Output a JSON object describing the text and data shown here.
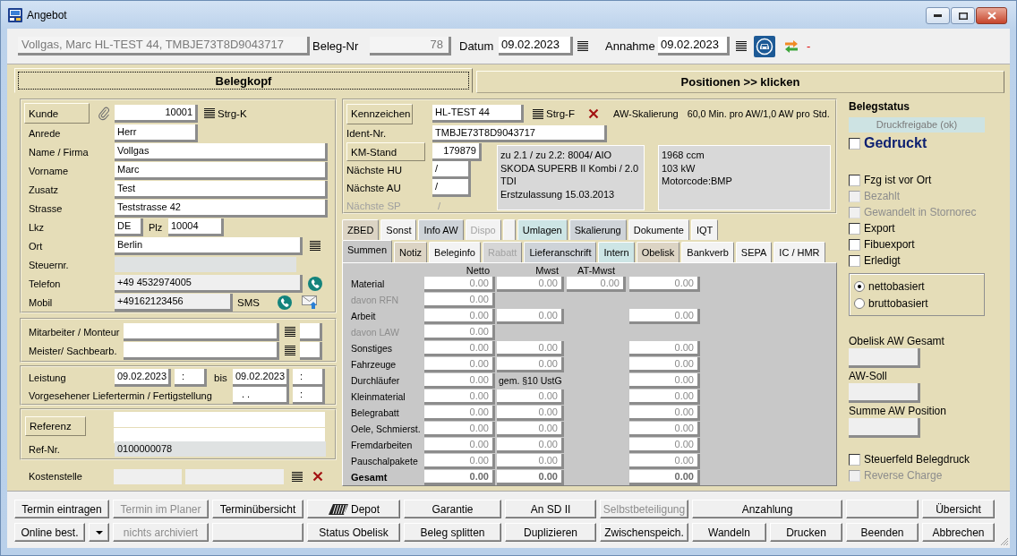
{
  "window": {
    "title": "Angebot"
  },
  "header": {
    "summary": "Vollgas, Marc HL-TEST 44, TMBJE73T8D9043717",
    "beleg_nr_label": "Beleg-Nr",
    "beleg_nr": "78",
    "datum_label": "Datum",
    "datum": "09.02.2023",
    "annahme_label": "Annahme",
    "annahme": "09.02.2023",
    "status": "-"
  },
  "main_tabs": [
    {
      "label": "Belegkopf",
      "selected": true
    },
    {
      "label": "Positionen >> klicken",
      "selected": false
    }
  ],
  "customer": {
    "kunde_button": "Kunde",
    "kunde": "10001",
    "kunde_shortcut": "Strg-K",
    "fields": [
      {
        "kind": "short",
        "label": "Anrede",
        "value": "Herr"
      },
      {
        "kind": "full",
        "label": "Name / Firma",
        "value": "Vollgas"
      },
      {
        "kind": "full",
        "label": "Vorname",
        "value": "Marc"
      },
      {
        "kind": "full",
        "label": "Zusatz",
        "value": "Test"
      },
      {
        "kind": "full",
        "label": "Strasse",
        "value": "Teststrasse 42"
      },
      {
        "kind": "country",
        "label": "Lkz",
        "value": "DE",
        "plz_label": "Plz",
        "plz": "10004"
      },
      {
        "kind": "lookup",
        "label": "Ort",
        "value": "Berlin"
      },
      {
        "kind": "locked",
        "label": "Steuernr."
      },
      {
        "kind": "phone",
        "label": "Telefon",
        "value": "+49 4532974005"
      },
      {
        "kind": "mobile",
        "label": "Mobil",
        "value": "+49162123456",
        "sms_label": "SMS"
      }
    ]
  },
  "staff": [
    {
      "label": "Mitarbeiter / Monteur"
    },
    {
      "label": "Meister/ Sachbearb."
    }
  ],
  "service_period": {
    "label": "Leistung",
    "from_date": "09.02.2023",
    "from_time": ":",
    "to_label": "bis",
    "to_date": "09.02.2023",
    "to_time": ":"
  },
  "delivery": {
    "label": "Vorgesehener Liefertermin / Fertigstellung",
    "date": ". .",
    "time": ":"
  },
  "reference": {
    "button": "Referenz",
    "ref_nr_label": "Ref-Nr.",
    "ref_nr": "0100000078"
  },
  "cost_center": {
    "label": "Kostenstelle"
  },
  "vehicle": {
    "plate_button": "Kennzeichen",
    "plate": "HL-TEST 44",
    "plate_shortcut": "Strg-F",
    "scaling_label": "AW-Skalierung",
    "scaling": "60,0 Min. pro AW/1,0 AW pro Std.",
    "ident_label": "Ident-Nr.",
    "ident": "TMBJE73T8D9043717",
    "km_button": "KM-Stand",
    "km": "179879",
    "inspections": [
      {
        "label": "Nächste HU",
        "value": "/",
        "disabled": false
      },
      {
        "label": "Nächste AU",
        "value": "/",
        "disabled": false
      },
      {
        "label": "Nächste SP",
        "value": "/",
        "disabled": true
      }
    ],
    "model_lines": [
      "zu 2.1 / zu 2.2: 8004/ AIO",
      "SKODA SUPERB II Kombi / 2.0",
      "TDI",
      "Erstzulassung 15.03.2013"
    ],
    "engine_lines": [
      "1968 ccm",
      "103 kW",
      "Motorcode:BMP"
    ]
  },
  "detail_tab_rows": [
    {
      "tabs": [
        {
          "label": "ZBED",
          "selected": false,
          "disabled": false,
          "color": "#dcd4c4"
        },
        {
          "label": "Sonst",
          "selected": false,
          "disabled": false,
          "color": "#f3f3f3"
        },
        {
          "label": "Info AW",
          "selected": false,
          "disabled": false,
          "color": "#ced3d8"
        },
        {
          "label": "Dispo",
          "selected": false,
          "disabled": true,
          "color": "#f3f3f3"
        },
        {
          "selected": false,
          "color": "#f3f3f3"
        },
        {
          "label": "Umlagen",
          "selected": false,
          "disabled": false,
          "color": "#cde5e5"
        },
        {
          "label": "Skalierung",
          "selected": false,
          "disabled": false,
          "color": "#ced3d8"
        },
        {
          "label": "Dokumente",
          "selected": false,
          "disabled": false,
          "color": "#f3f3f3"
        },
        {
          "label": "IQT",
          "selected": false,
          "disabled": false,
          "color": "#f3f3f3"
        }
      ]
    },
    {
      "tabs": [
        {
          "label": "Summen",
          "selected": true,
          "disabled": false,
          "color": "#c8c8c8"
        },
        {
          "label": "Notiz",
          "selected": false,
          "disabled": false,
          "color": "#dcd4c4"
        },
        {
          "label": "Beleginfo",
          "selected": false,
          "disabled": false,
          "color": "#f3f3f3"
        },
        {
          "label": "Rabatt",
          "selected": false,
          "disabled": true,
          "color": "#d6d6d6"
        },
        {
          "label": "Lieferanschrift",
          "selected": false,
          "disabled": false,
          "color": "#ced3d8"
        },
        {
          "label": "Intern",
          "selected": false,
          "disabled": false,
          "color": "#cde5e5"
        },
        {
          "label": "Obelisk",
          "selected": false,
          "disabled": false,
          "color": "#dcd4c4"
        },
        {
          "label": "Bankverb",
          "selected": false,
          "disabled": false,
          "color": "#f3f3f3"
        },
        {
          "label": "SEPA",
          "selected": false,
          "disabled": false,
          "color": "#f3f3f3"
        },
        {
          "label": "IC / HMR",
          "selected": false,
          "disabled": false,
          "color": "#f3f3f3"
        }
      ]
    }
  ],
  "totals": {
    "columns": [
      "Netto",
      "Mwst",
      "AT-Mwst"
    ],
    "rows": [
      {
        "kind": "item",
        "label": "Material",
        "netto": "0.00",
        "mwst": "0.00",
        "at_mwst": "0.00",
        "column_4": "0.00"
      },
      {
        "kind": "sub",
        "label": "davon RFN",
        "netto": "0.00"
      },
      {
        "kind": "item",
        "label": "Arbeit",
        "netto": "0.00",
        "mwst": "0.00",
        "column_4": "0.00"
      },
      {
        "kind": "sub",
        "label": "davon LAW",
        "netto": "0.00"
      },
      {
        "kind": "item",
        "label": "Sonstiges",
        "netto": "0.00",
        "mwst": "0.00",
        "column_4": "0.00"
      },
      {
        "kind": "item",
        "label": "Fahrzeuge",
        "netto": "0.00",
        "mwst": "0.00",
        "column_4": "0.00"
      },
      {
        "kind": "item",
        "label": "Durchläufer",
        "netto": "0.00",
        "note": "gem. §10 UstG",
        "column_4": "0.00"
      },
      {
        "kind": "item",
        "label": "Kleinmaterial",
        "netto": "0.00",
        "mwst": "0.00",
        "column_4": "0.00"
      },
      {
        "kind": "item",
        "label": "Belegrabatt",
        "netto": "0.00",
        "mwst": "0.00",
        "column_4": "0.00"
      },
      {
        "kind": "item",
        "label": "Oele, Schmierst.",
        "netto": "0.00",
        "mwst": "0.00",
        "column_4": "0.00"
      },
      {
        "kind": "item",
        "label": "Fremdarbeiten",
        "netto": "0.00",
        "mwst": "0.00",
        "column_4": "0.00"
      },
      {
        "kind": "item",
        "label": "Pauschalpakete",
        "netto": "0.00",
        "mwst": "0.00",
        "column_4": "0.00"
      },
      {
        "kind": "total",
        "label": "Gesamt",
        "netto": "0.00",
        "mwst": "0.00",
        "column_4": "0.00"
      }
    ]
  },
  "status": {
    "title": "Belegstatus",
    "release": "Druckfreigabe (ok)",
    "printed": {
      "label": "Gedruckt",
      "checked": false
    },
    "flags": [
      {
        "label": "Fzg ist vor Ort",
        "checked": false,
        "disabled": false
      },
      {
        "label": "Bezahlt",
        "checked": false,
        "disabled": true
      },
      {
        "label": "Gewandelt in Stornorec",
        "checked": false,
        "disabled": true
      },
      {
        "label": "Export",
        "checked": false,
        "disabled": false
      },
      {
        "label": "Fibuexport",
        "checked": false,
        "disabled": false
      },
      {
        "label": "Erledigt",
        "checked": false,
        "disabled": false
      }
    ],
    "basis": [
      {
        "label": "nettobasiert",
        "selected": true
      },
      {
        "label": "bruttobasiert",
        "selected": false
      }
    ],
    "aw_fields": [
      {
        "label": "Obelisk AW Gesamt"
      },
      {
        "label": "AW-Soll"
      },
      {
        "label": "Summe AW Position"
      }
    ],
    "print_flags": [
      {
        "label": "Steuerfeld Belegdruck",
        "checked": false,
        "disabled": false
      },
      {
        "label": "Reverse Charge",
        "checked": false,
        "disabled": true
      }
    ]
  },
  "action_rows": [
    {
      "buttons": [
        {
          "kind": "text",
          "label": "Termin eintragen",
          "disabled": false
        },
        {
          "kind": "text",
          "label": "Termin im Planer",
          "disabled": true
        },
        {
          "kind": "text",
          "label": "Terminübersicht",
          "disabled": false
        },
        {
          "kind": "icon",
          "label": "Depot",
          "disabled": false
        },
        {
          "kind": "text",
          "label": "Garantie",
          "disabled": false
        },
        {
          "kind": "text",
          "label": "An SD II",
          "disabled": false
        },
        {
          "kind": "text",
          "label": "Selbstbeteiligung",
          "disabled": true
        },
        {
          "kind": "text",
          "label": "Anzahlung",
          "disabled": false
        },
        {
          "kind": "blank"
        },
        {
          "kind": "text",
          "label": "Übersicht",
          "disabled": false
        }
      ]
    },
    {
      "buttons": [
        {
          "kind": "text",
          "label": "Online best.",
          "disabled": false
        },
        {
          "kind": "dropdown",
          "disabled": false
        },
        {
          "kind": "text",
          "label": "nichts archiviert",
          "disabled": true
        },
        {
          "kind": "blank"
        },
        {
          "kind": "text",
          "label": "Status Obelisk",
          "disabled": false
        },
        {
          "kind": "text",
          "label": "Beleg splitten",
          "disabled": false
        },
        {
          "kind": "text",
          "label": "Duplizieren",
          "disabled": false
        },
        {
          "kind": "text",
          "label": "Zwischenspeich.",
          "disabled": false
        },
        {
          "kind": "text",
          "label": "Wandeln",
          "disabled": false
        },
        {
          "kind": "text",
          "label": "Drucken",
          "disabled": false
        },
        {
          "kind": "text",
          "label": "Beenden",
          "disabled": false
        },
        {
          "kind": "text",
          "label": "Abbrechen",
          "disabled": false
        }
      ]
    }
  ]
}
